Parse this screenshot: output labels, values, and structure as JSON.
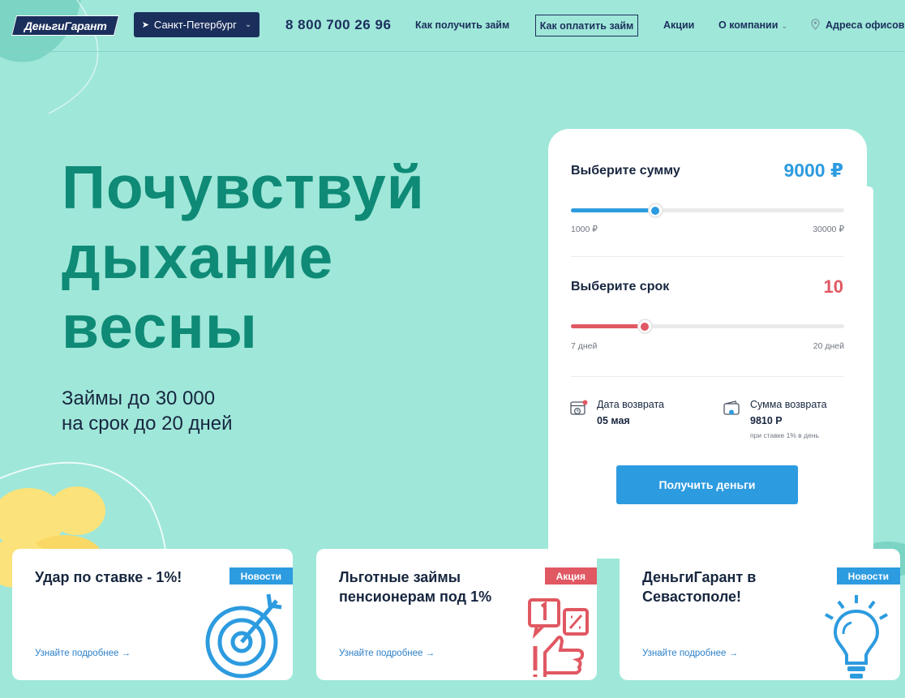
{
  "header": {
    "logo_text": "ДеньгиГарант",
    "city": "Санкт-Петербург",
    "phone": "8 800 700 26 96",
    "nav": {
      "how_to_get": "Как получить займ",
      "how_to_pay": "Как оплатить займ",
      "promos": "Акции",
      "about": "О компании",
      "offices": "Адреса офисов"
    }
  },
  "hero": {
    "title_line1": "Почувствуй",
    "title_line2": "дыхание",
    "title_line3": "весны",
    "sub_line1": "Займы до 30 000",
    "sub_line2": "на срок до 20 дней"
  },
  "calculator": {
    "amount_label": "Выберите сумму",
    "amount_value": "9000 ₽",
    "amount_min": "1000 ₽",
    "amount_max": "30000 ₽",
    "amount_fraction": 0.31,
    "term_label": "Выберите срок",
    "term_value": "10",
    "term_min": "7 дней",
    "term_max": "20 дней",
    "term_fraction": 0.27,
    "return_date_label": "Дата возврата",
    "return_date_value": "05 мая",
    "return_sum_label": "Сумма возврата",
    "return_sum_value": "9810 Р",
    "rate_note": "при ставке 1% в день",
    "cta": "Получить деньги",
    "colors": {
      "amount": "#2d9bdf",
      "term": "#e05862"
    }
  },
  "promos": [
    {
      "title_line1": "Удар по ставке - 1%!",
      "title_line2": "",
      "badge": "Новости",
      "badge_color": "#2d9bdf",
      "link": "Узнайте подробнее →",
      "icon": "target-icon"
    },
    {
      "title_line1": "Льготные займы",
      "title_line2": "пенсионерам под 1%",
      "badge": "Акция",
      "badge_color": "#e05862",
      "link": "Узнайте подробнее →",
      "icon": "thumbs-up-percent-icon"
    },
    {
      "title_line1": "ДеньгиГарант в",
      "title_line2": "Севастополе!",
      "badge": "Новости",
      "badge_color": "#2d9bdf",
      "link": "Узнайте подробнее →",
      "icon": "lightbulb-icon"
    }
  ]
}
